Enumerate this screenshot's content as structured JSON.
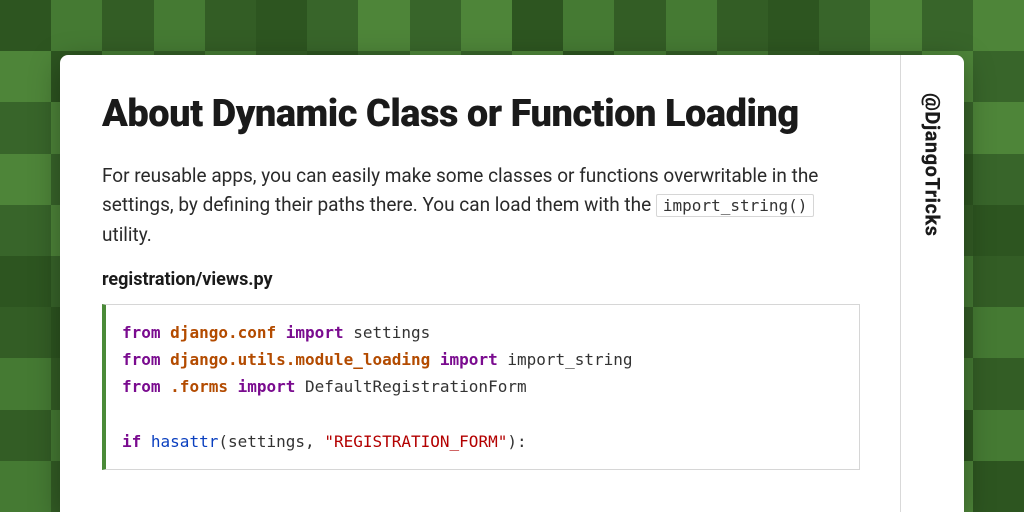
{
  "handle": "@DjangoTricks",
  "title": "About Dynamic Class or Function Loading",
  "intro_part1": "For reusable apps, you can easily make some classes or functions overwritable in the settings, by defining their paths there. You can load them with the ",
  "intro_code": "import_string()",
  "intro_part2": " utility.",
  "filename": "registration/views.py",
  "code": {
    "l1_kw1": "from",
    "l1_mod": "django.conf",
    "l1_kw2": "import",
    "l1_rest": " settings",
    "l2_kw1": "from",
    "l2_mod": "django.utils.module_loading",
    "l2_kw2": "import",
    "l2_rest": " import_string",
    "l3_kw1": "from",
    "l3_mod": ".forms",
    "l3_kw2": "import",
    "l3_rest": " DefaultRegistrationForm",
    "l5_kw": "if",
    "l5_fn": "hasattr",
    "l5_mid": "(settings, ",
    "l5_str": "\"REGISTRATION_FORM\"",
    "l5_end": "):"
  }
}
